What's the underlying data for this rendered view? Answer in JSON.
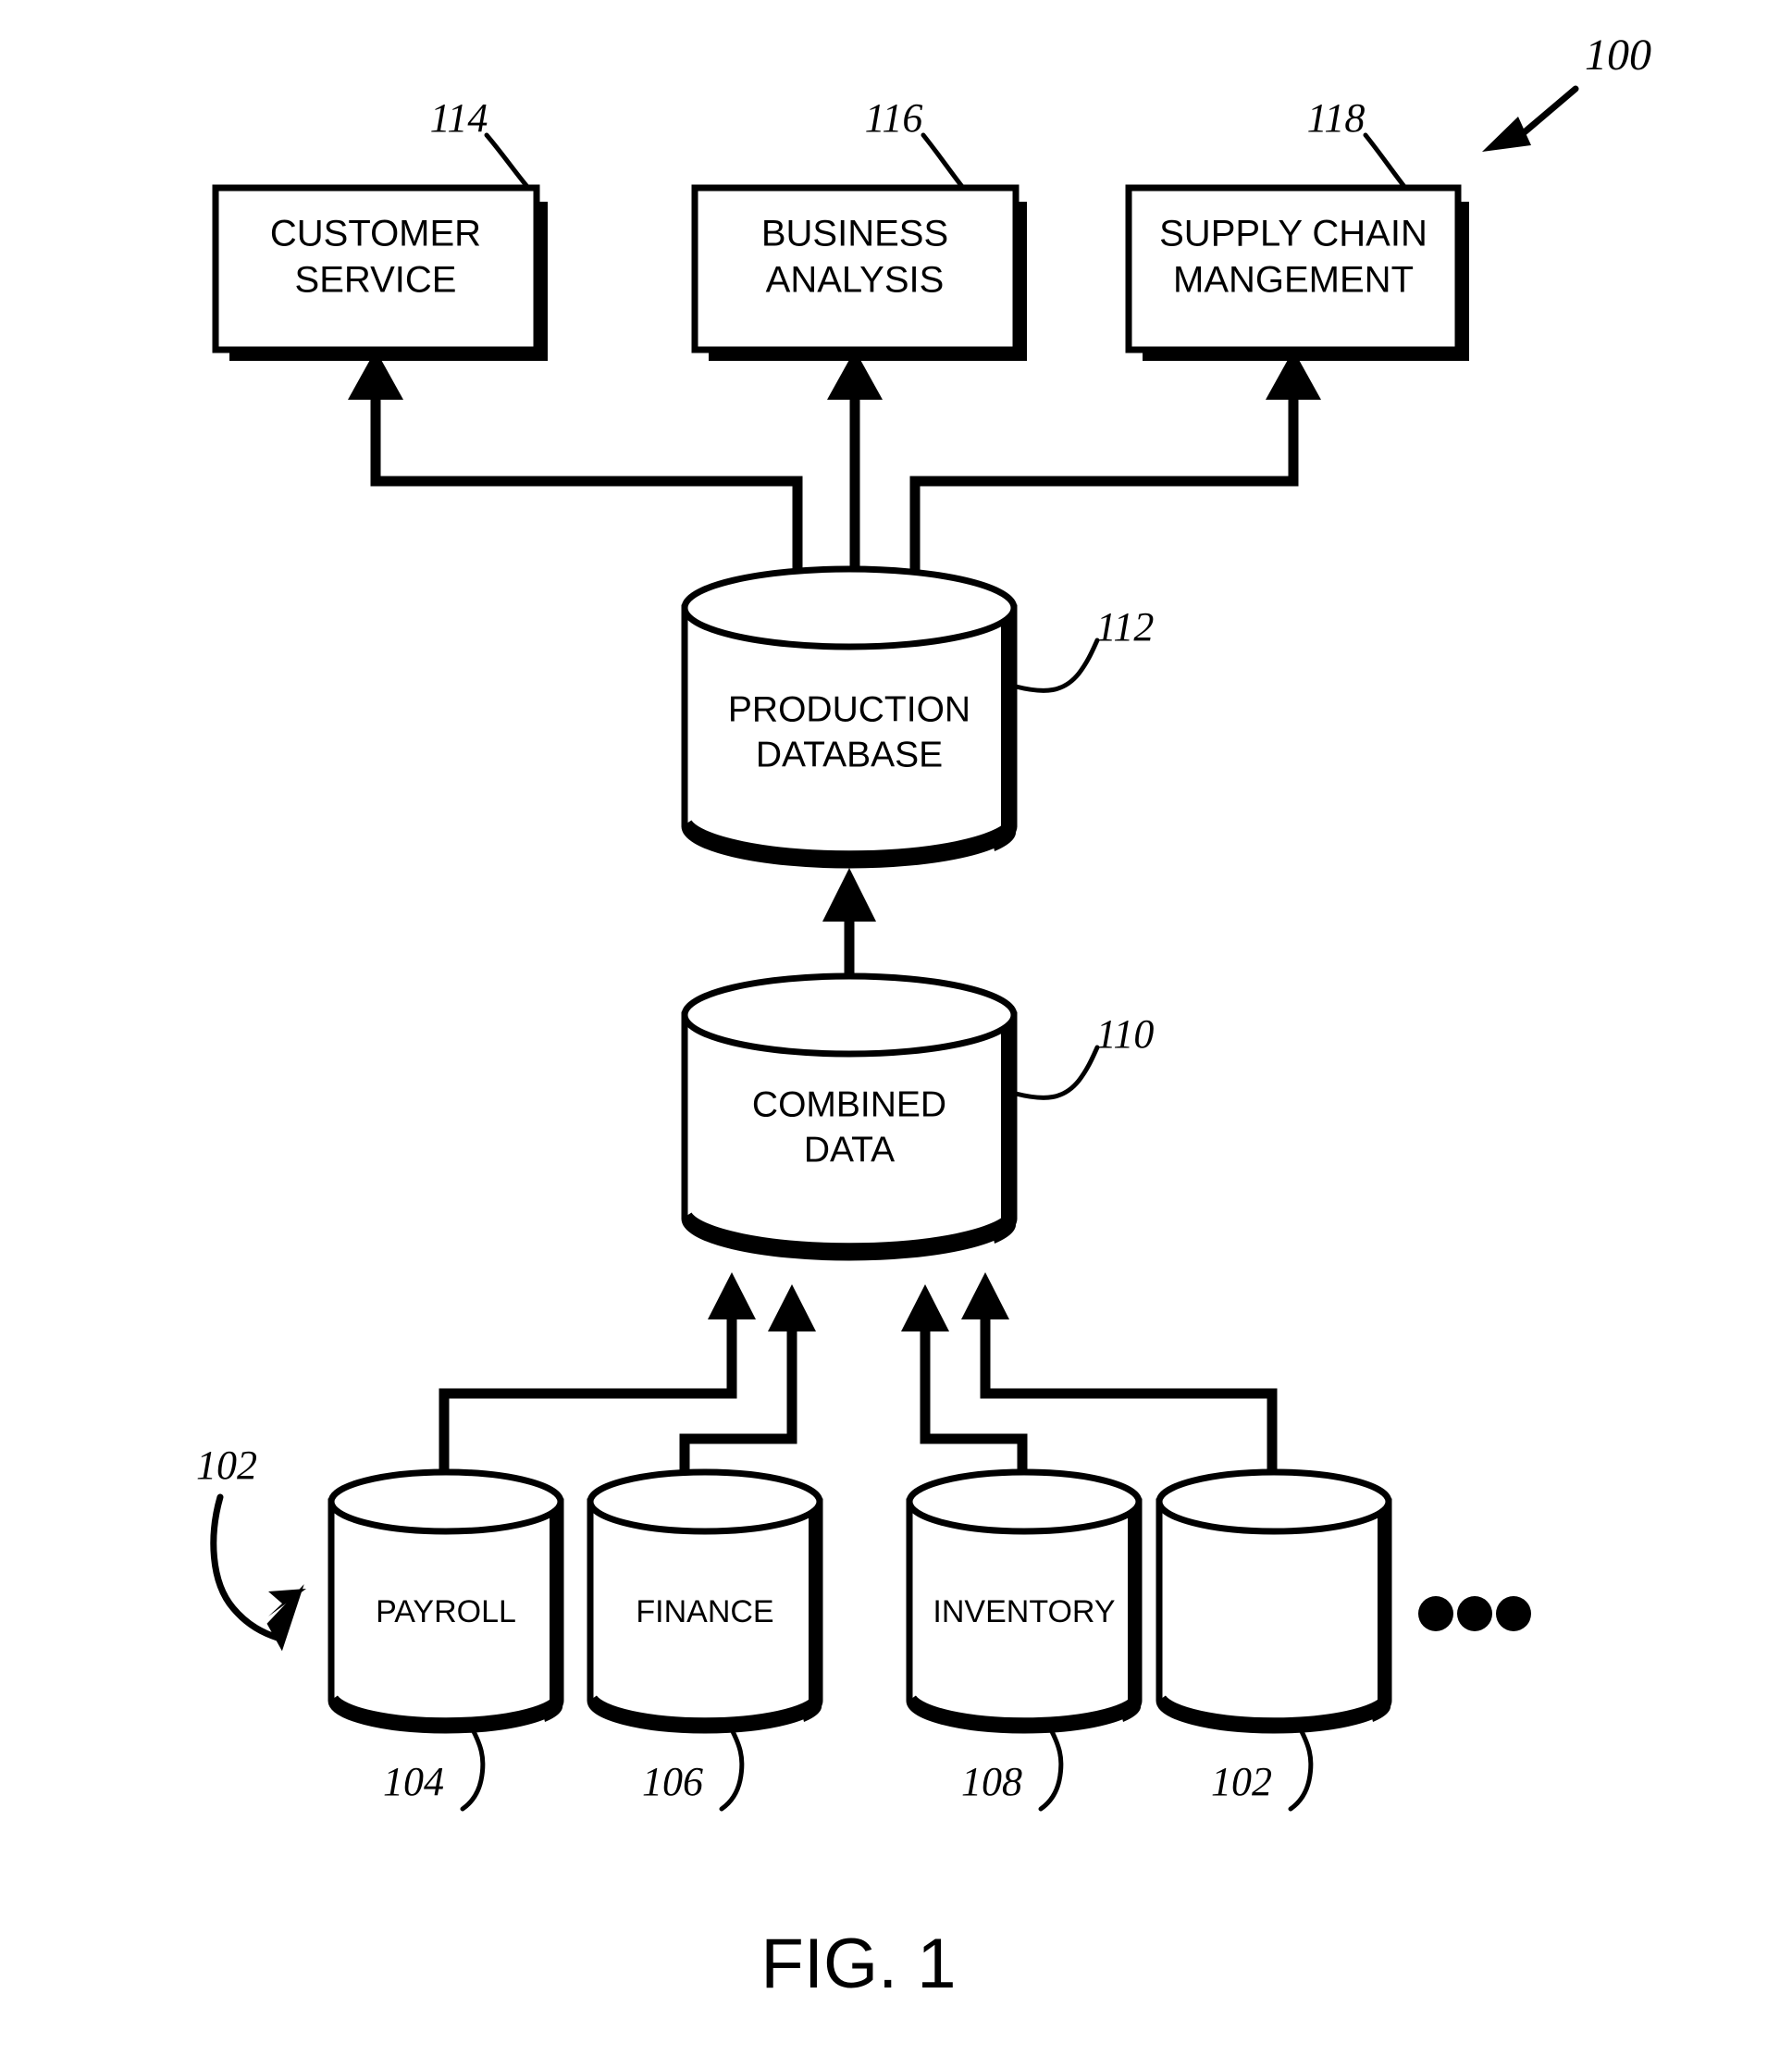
{
  "figure": {
    "caption": "FIG. 1",
    "system_ref": "100",
    "system_ref_name": "system-reference-100"
  },
  "consumers": [
    {
      "label_line1": "CUSTOMER",
      "label_line2": "SERVICE",
      "ref": "114"
    },
    {
      "label_line1": "BUSINESS",
      "label_line2": "ANALYSIS",
      "ref": "116"
    },
    {
      "label_line1": "SUPPLY CHAIN",
      "label_line2": "MANGEMENT",
      "ref": "118"
    }
  ],
  "databases": [
    {
      "label_line1": "PRODUCTION",
      "label_line2": "DATABASE",
      "ref": "112"
    },
    {
      "label_line1": "COMBINED",
      "label_line2": "DATA",
      "ref": "110"
    }
  ],
  "sources": {
    "group_ref": "102",
    "items": [
      {
        "label": "PAYROLL",
        "ref": "104"
      },
      {
        "label": "FINANCE",
        "ref": "106"
      },
      {
        "label": "INVENTORY",
        "ref": "108"
      },
      {
        "label": "",
        "ref": "102"
      }
    ],
    "ellipsis": "• • •"
  },
  "colors": {
    "ink": "#000000",
    "paper": "#ffffff"
  }
}
